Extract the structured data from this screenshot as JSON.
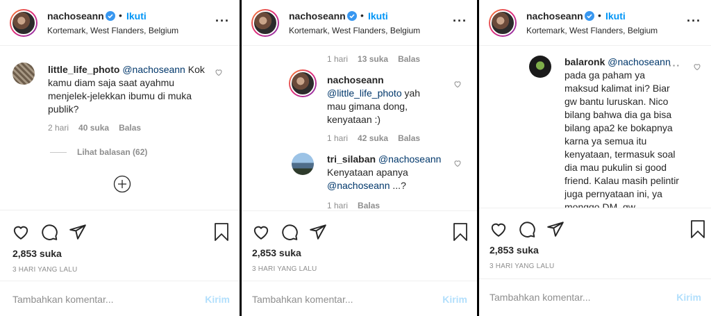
{
  "post": {
    "username": "nachoseann",
    "dot": "•",
    "follow_label": "Ikuti",
    "location": "Kortemark, West Flanders, Belgium",
    "likes": "2,853 suka",
    "time_ago": "3 HARI YANG LALU",
    "add_comment_placeholder": "Tambahkan komentar...",
    "send_label": "Kirim"
  },
  "panel1": {
    "comment": {
      "user": "little_life_photo",
      "mention": "@nachoseann",
      "text": "Kok kamu diam saja saat ayahmu menjelek-jelekkan ibumu di muka publik?",
      "time": "2 hari",
      "likes": "40 suka",
      "reply": "Balas"
    },
    "view_replies": "Lihat balasan (62)"
  },
  "panel2": {
    "top_meta": {
      "time": "1 hari",
      "likes": "13 suka",
      "reply": "Balas"
    },
    "reply1": {
      "user": "nachoseann",
      "mention": "@little_life_photo",
      "text": "yah mau gimana dong, kenyataan :)",
      "time": "1 hari",
      "likes": "42 suka",
      "reply": "Balas"
    },
    "reply2": {
      "user": "tri_silaban",
      "mention": "@nachoseann",
      "text": "Kenyataan apanya",
      "mention2": "@nachoseann",
      "text2": "...?",
      "time": "1 hari",
      "reply": "Balas"
    }
  },
  "panel3": {
    "reply": {
      "user": "balaronk",
      "mention": "@nachoseann",
      "text": "pada ga paham ya maksud kalimat ini? Biar gw bantu luruskan. Nico bilang bahwa dia ga bisa bilang apa2 ke bokapnya karna ya semua itu kenyataan, termasuk soal dia mau pukulin si good friend. Kalau masih pelintir juga pernyataan ini, ya monggo DM, gw"
    }
  },
  "colors": {
    "link_blue": "#0095f6",
    "mention_blue": "#00376b",
    "gray": "#8e8e8e",
    "verified": "#3897f0"
  }
}
